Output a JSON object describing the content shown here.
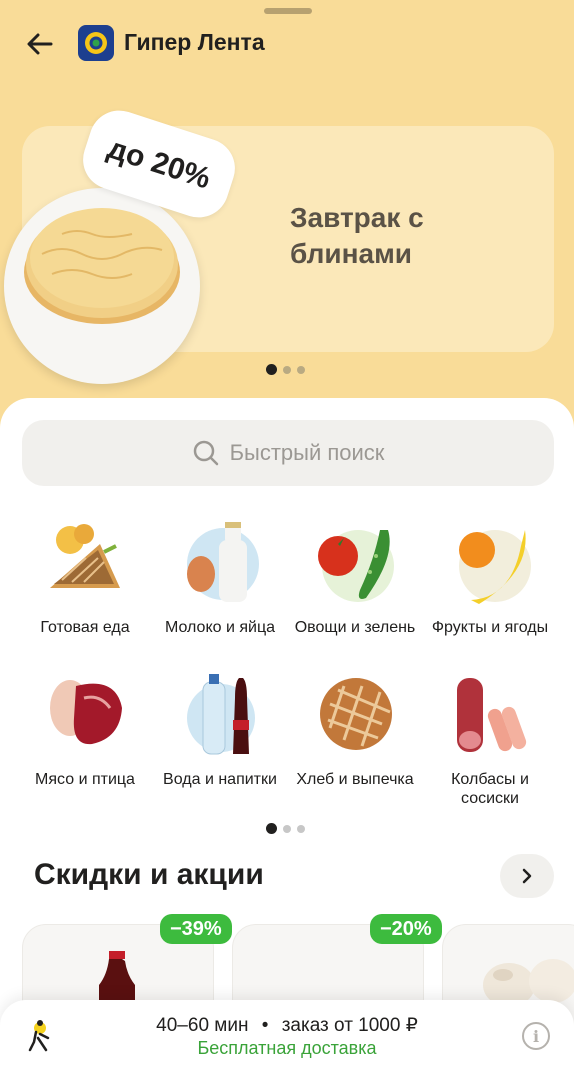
{
  "header": {
    "store_name": "Гипер Лента"
  },
  "banner": {
    "discount": "до 20%",
    "title": "Завтрак с блинами"
  },
  "search": {
    "placeholder": "Быстрый поиск"
  },
  "categories": [
    {
      "label": "Готовая еда",
      "icon": "sandwich-icon"
    },
    {
      "label": "Молоко и яйца",
      "icon": "milk-icon"
    },
    {
      "label": "Овощи и зелень",
      "icon": "vegetables-icon"
    },
    {
      "label": "Фрукты и ягоды",
      "icon": "fruits-icon"
    },
    {
      "label": "Мясо и птица",
      "icon": "meat-icon"
    },
    {
      "label": "Вода и напитки",
      "icon": "drinks-icon"
    },
    {
      "label": "Хлеб и выпечка",
      "icon": "bread-icon"
    },
    {
      "label": "Колбасы и сосиски",
      "icon": "sausage-icon"
    }
  ],
  "deals": {
    "title": "Скидки и акции",
    "badges": [
      "−39%",
      "−20%"
    ]
  },
  "footer": {
    "delivery_time": "40–60 мин",
    "separator": "•",
    "min_order": "заказ от 1000 ₽",
    "free_delivery": "Бесплатная доставка"
  },
  "colors": {
    "accent_bg": "#f9dc98",
    "discount_green": "#3dbb3e",
    "free_delivery_green": "#3aa339"
  }
}
